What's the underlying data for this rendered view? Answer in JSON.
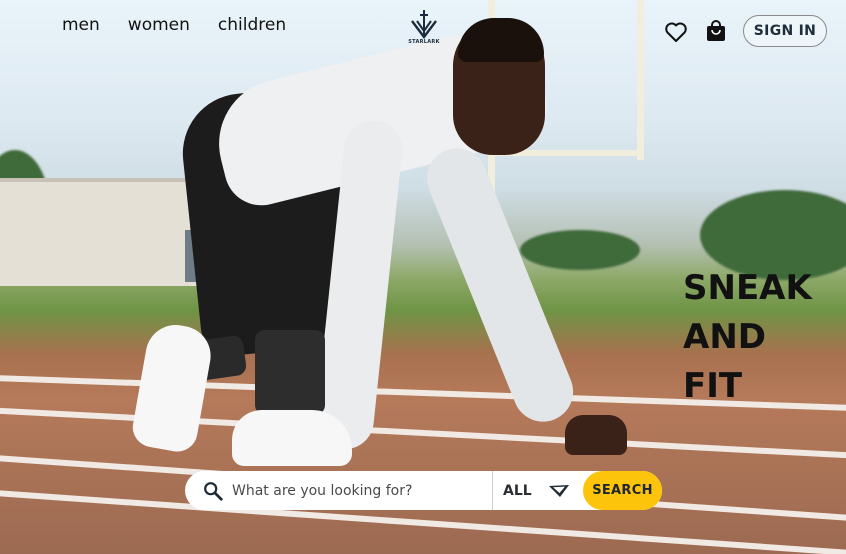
{
  "nav": {
    "links": [
      {
        "label": "men"
      },
      {
        "label": "women"
      },
      {
        "label": "children"
      }
    ]
  },
  "brand": {
    "logo_text": "STARLARK"
  },
  "header_actions": {
    "wishlist_icon": "heart-icon",
    "cart_icon": "shopping-bag-icon",
    "signin_label": "SIGN IN"
  },
  "hero": {
    "headline_lines": [
      "SNEAK",
      "AND",
      "FIT"
    ]
  },
  "search": {
    "placeholder": "What are you looking for?",
    "value": "",
    "category_value": "ALL",
    "button_label": "SEARCH",
    "icon": "search-icon"
  },
  "colors": {
    "accent": "#fcc40a",
    "text_dark": "#121212",
    "search_bg": "#ffffff"
  }
}
